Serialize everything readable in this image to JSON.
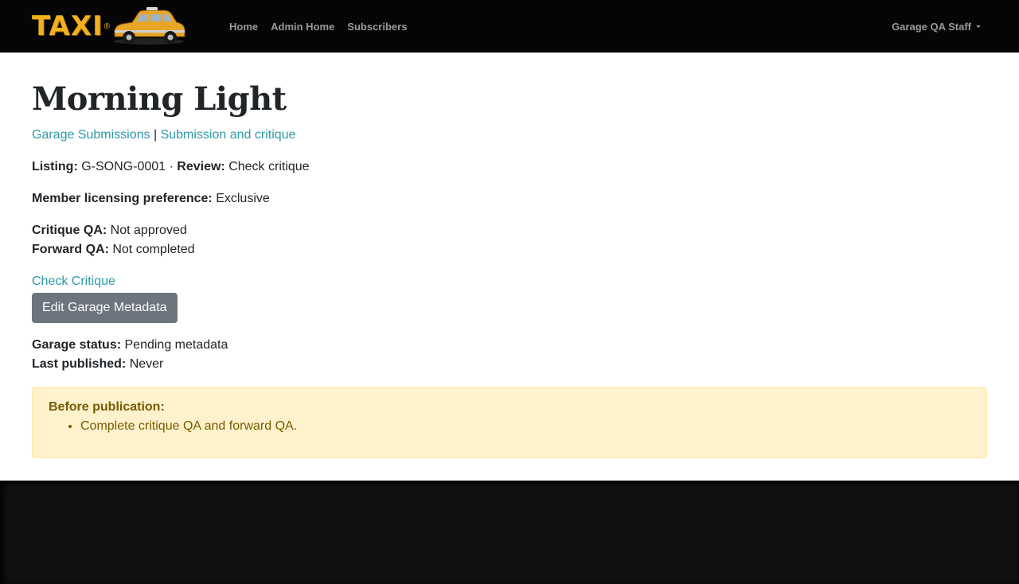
{
  "navbar": {
    "brand": "TAXI",
    "brand_mark": "®",
    "links": [
      "Home",
      "Admin Home",
      "Subscribers"
    ],
    "user_menu": "Garage QA Staff"
  },
  "page": {
    "title": "Morning Light",
    "breadcrumb": {
      "first": "Garage Submissions",
      "separator": "|",
      "second": "Submission and critique"
    },
    "listing_label": "Listing:",
    "listing_value": "G-SONG-0001",
    "dot": "·",
    "review_label": "Review:",
    "review_value": "Check critique",
    "licensing_label": "Member licensing preference:",
    "licensing_value": "Exclusive",
    "critique_qa_label": "Critique QA:",
    "critique_qa_value": "Not approved",
    "forward_qa_label": "Forward QA:",
    "forward_qa_value": "Not completed",
    "check_critique_link": "Check Critique",
    "edit_button": "Edit Garage Metadata",
    "garage_status_label": "Garage status:",
    "garage_status_value": "Pending metadata",
    "last_published_label": "Last published:",
    "last_published_value": "Never"
  },
  "alert": {
    "heading": "Before publication:",
    "items": [
      "Complete critique QA and forward QA."
    ]
  },
  "colors": {
    "navbar_bg": "#050505",
    "link": "#2c9aa6",
    "button_bg": "#6c757d",
    "alert_bg": "#fef2cc",
    "alert_text": "#7a5a00",
    "footer_bg": "#111111"
  }
}
